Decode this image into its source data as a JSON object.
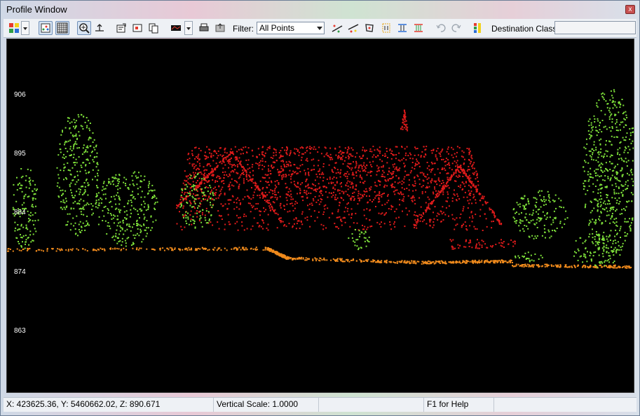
{
  "window": {
    "title": "Profile Window",
    "close_label": "x"
  },
  "toolbar": {
    "filter_label": "Filter:",
    "filter_value": "All Points",
    "destination_label": "Destination Class:",
    "destination_value": ""
  },
  "plot": {
    "y_ticks": [
      "906",
      "895",
      "884",
      "874",
      "863"
    ]
  },
  "status": {
    "coordinates": "X: 423625.36, Y: 5460662.02, Z: 890.671",
    "vertical_scale": "Vertical Scale: 1.0000",
    "empty_cell": "",
    "help": "F1 for Help"
  },
  "colors": {
    "roof_points": "#e01b1b",
    "vegetation_points": "#7ee03a",
    "ground_points": "#f08a1c",
    "background": "#000000"
  }
}
